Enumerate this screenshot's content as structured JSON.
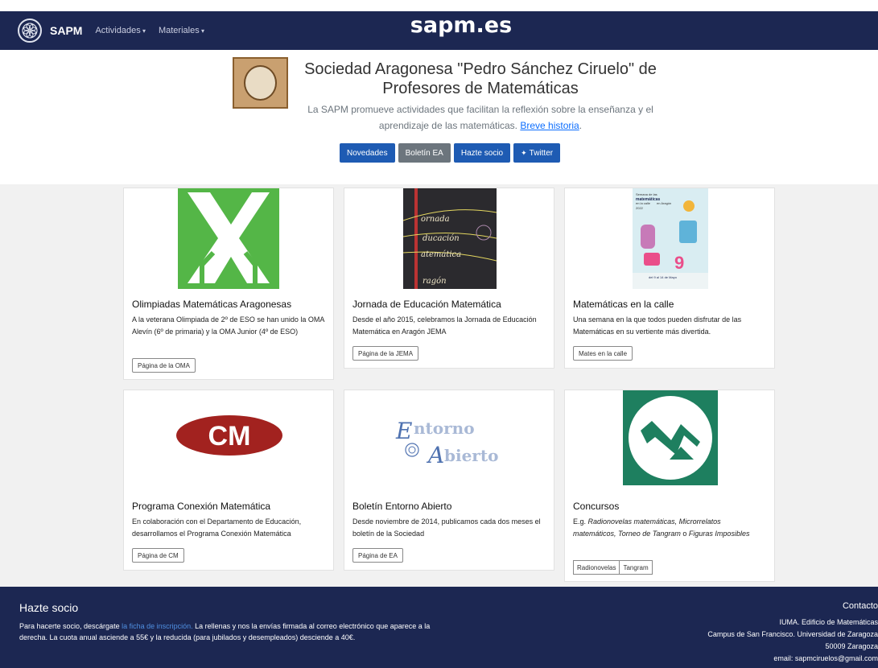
{
  "overlay_title": "sapm.es",
  "navbar": {
    "brand": "SAPM",
    "items": [
      {
        "label": "Actividades"
      },
      {
        "label": "Materiales"
      }
    ]
  },
  "hero": {
    "title": "Sociedad Aragonesa \"Pedro Sánchez Ciruelo\" de Profesores de Matemáticas",
    "lead": "La SAPM promueve actividades que facilitan la reflexión sobre la enseñanza y el aprendizaje de las matemáticas.",
    "lead_link": "Breve historia",
    "lead_end": ".",
    "buttons": [
      {
        "label": "Novedades"
      },
      {
        "label": "Boletín EA"
      },
      {
        "label": "Hazte socio"
      },
      {
        "label": "Twitter"
      }
    ]
  },
  "cards": [
    {
      "title": "Olimpiadas Matemáticas Aragonesas",
      "text": "A la veterana Olimpiada de 2º de ESO se han unido la OMA Alevín (6º de primaria) y la OMA Junior (4º de ESO)",
      "button": "Página de la OMA"
    },
    {
      "title": "Jornada de Educación Matemática",
      "text": "Desde el año 2015, celebramos la Jornada de Educación Matemática en Aragón JEMA",
      "button": "Página de la JEMA",
      "image_words": [
        "ornada",
        "ducación",
        "atemática",
        "ragón"
      ]
    },
    {
      "title": "Matemáticas en la calle",
      "text": "Una semana en la que todos pueden disfrutar de las Matemáticas en su vertiente más divertida.",
      "button": "Mates en la calle",
      "poster_text": [
        "Semana de las",
        "matemáticas",
        "en la calle",
        "en Aragón",
        "2022",
        "del 9 al 14 de Mayo"
      ]
    },
    {
      "title": "Programa Conexión Matemática",
      "text": "En colaboración con el Departamento de Educación, desarrollamos el Programa Conexión Matemática",
      "button": "Página de CM",
      "logo_text": "CM"
    },
    {
      "title": "Boletín Entorno Abierto",
      "text": "Desde noviembre de 2014, publicamos cada dos meses el boletín de la Sociedad",
      "button": "Página de EA",
      "logo_lines": [
        "E",
        "ntorno",
        "A",
        "bierto"
      ]
    },
    {
      "title": "Concursos",
      "text_prefix": "E.g. ",
      "text_italic_1": "Radionovelas matemáticas, Microrrelatos matemáticos, Torneo de Tangram",
      "text_mid": " o ",
      "text_italic_2": "Figuras Imposibles",
      "buttons": [
        "Radionovelas",
        "Tangram"
      ]
    }
  ],
  "footer": {
    "title": "Hazte socio",
    "text_1": "Para hacerte socio, descárgate ",
    "link": "la ficha de inscripción.",
    "text_2": " La rellenas y nos la envías firmada al correo electrónico que aparece a la derecha. La cuota anual asciende a 55€ y la reducida (para jubilados y desempleados) desciende a 40€.",
    "contact_title": "Contacto",
    "contact_lines": [
      "IUMA. Edificio de Matemáticas",
      "Campus de San Francisco. Universidad de Zaragoza",
      "50009 Zaragoza",
      "email: sapmciruelos@gmail.com"
    ]
  },
  "colors": {
    "navbar": "#1c2752",
    "oma_green": "#54b647",
    "concursos_green": "#1e7f5f",
    "cm_red": "#a2221f",
    "button_blue": "#1e5bb3"
  }
}
